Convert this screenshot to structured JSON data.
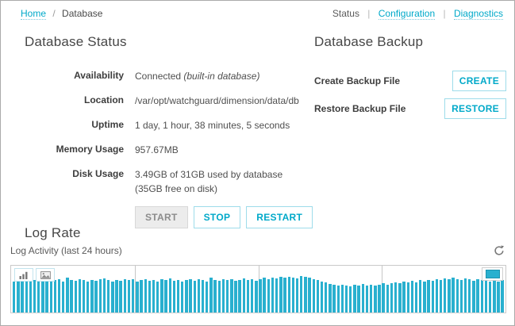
{
  "header": {
    "breadcrumb": {
      "home": "Home",
      "separator": "/",
      "current": "Database"
    },
    "nav": {
      "status": "Status",
      "configuration": "Configuration",
      "diagnostics": "Diagnostics",
      "separator": "|"
    }
  },
  "database_status": {
    "title": "Database Status",
    "fields": [
      {
        "label": "Availability",
        "value": "Connected",
        "value_italic": "(built-in database)"
      },
      {
        "label": "Location",
        "value": "/var/opt/watchguard/dimension/data/db"
      },
      {
        "label": "Uptime",
        "value": "1 day, 1 hour, 38 minutes, 5 seconds"
      },
      {
        "label": "Memory Usage",
        "value": "957.67MB"
      },
      {
        "label": "Disk Usage",
        "value": "3.49GB of 31GB used by database (35GB free on disk)"
      }
    ],
    "buttons": {
      "start": "START",
      "stop": "STOP",
      "restart": "RESTART"
    }
  },
  "database_backup": {
    "title": "Database Backup",
    "rows": [
      {
        "label": "Create Backup File",
        "button": "CREATE"
      },
      {
        "label": "Restore Backup File",
        "button": "RESTORE"
      }
    ]
  },
  "log_rate": {
    "title": "Log Rate",
    "chart_label": "Log Activity (last 24 hours)"
  },
  "icons": {
    "refresh": "refresh-icon",
    "bar_chart": "bar-chart-icon",
    "image_export": "image-icon",
    "overview": "overview-swatch-icon"
  },
  "colors": {
    "accent": "#00a9c9",
    "bar": "#29b0cf",
    "button_border": "#9edcea",
    "page_border": "#ababab",
    "gridline": "#c6c6c6",
    "disabled_bg": "#ececec"
  },
  "chart_data": {
    "type": "bar",
    "title": "Log Activity (last 24 hours)",
    "xlabel": "time over last 24 hours (no tick labels shown)",
    "ylabel": "log rate (no axis labels shown)",
    "x_range_hours": 24,
    "bar_count": 120,
    "grid": "3 vertical gridlines at 6-hour intervals",
    "legend": "none",
    "bar_color": "#29b0cf",
    "value_units": "relative height, percent of chart height (estimated)",
    "values": [
      68,
      71,
      67,
      72,
      69,
      70,
      74,
      71,
      68,
      73,
      70,
      72,
      68,
      75,
      71,
      69,
      73,
      70,
      67,
      71,
      69,
      72,
      74,
      70,
      68,
      71,
      69,
      73,
      70,
      72,
      68,
      70,
      73,
      69,
      71,
      68,
      72,
      70,
      74,
      69,
      71,
      68,
      70,
      73,
      69,
      72,
      70,
      68,
      75,
      71,
      69,
      73,
      70,
      72,
      69,
      71,
      74,
      70,
      72,
      69,
      73,
      75,
      72,
      76,
      74,
      77,
      75,
      78,
      76,
      74,
      79,
      77,
      75,
      73,
      71,
      68,
      65,
      62,
      60,
      58,
      61,
      59,
      57,
      60,
      58,
      62,
      59,
      61,
      58,
      60,
      63,
      61,
      64,
      66,
      63,
      67,
      65,
      69,
      66,
      70,
      68,
      71,
      69,
      73,
      70,
      74,
      72,
      76,
      73,
      71,
      74,
      72,
      69,
      72,
      70,
      73,
      68,
      71,
      67,
      70
    ]
  }
}
